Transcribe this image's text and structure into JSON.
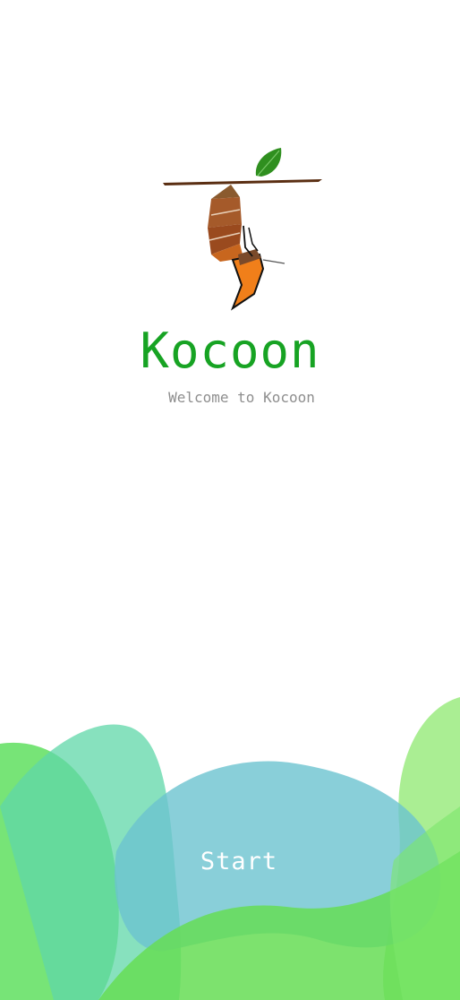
{
  "app": {
    "title": "Kocoon",
    "subtitle": "Welcome to Kocoon",
    "start_label": "Start"
  },
  "colors": {
    "title": "#17a323",
    "subtitle": "#8e8e8e",
    "blob_green_light": "#8ee86f",
    "blob_green": "#55dd55",
    "blob_teal": "#5fd7a8",
    "blob_blue": "#6cc3cf"
  },
  "icons": {
    "logo": "butterfly-emerging-from-cocoon-icon"
  }
}
